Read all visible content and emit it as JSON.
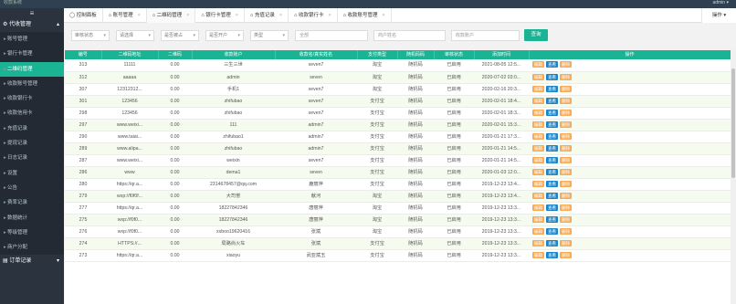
{
  "topbar": {
    "brand": "收款系统",
    "user": "admin ▾"
  },
  "sidebar": {
    "toggle": "≡",
    "group_top": "代收管理",
    "items": [
      {
        "label": "账号管理",
        "active": false
      },
      {
        "label": "银行卡管理",
        "active": false
      },
      {
        "label": "二维码管理",
        "active": true
      },
      {
        "label": "收款账号管理",
        "active": false
      },
      {
        "label": "收款银行卡",
        "active": false
      },
      {
        "label": "收款信用卡",
        "active": false
      },
      {
        "label": "充值记录",
        "active": false
      },
      {
        "label": "提现记录",
        "active": false
      },
      {
        "label": "日志记录",
        "active": false
      },
      {
        "label": "设置",
        "active": false
      },
      {
        "label": "公告",
        "active": false
      },
      {
        "label": "费率记录",
        "active": false
      },
      {
        "label": "数据统计",
        "active": false
      },
      {
        "label": "等级管理",
        "active": false
      },
      {
        "label": "商户分配",
        "active": false
      }
    ],
    "group_bottom": "订单记录"
  },
  "tabs": [
    {
      "label": "控制面板",
      "icon": "home-icon",
      "active": false
    },
    {
      "label": "账号管理",
      "active": false
    },
    {
      "label": "二维码管理",
      "active": true
    },
    {
      "label": "银行卡管理",
      "active": false
    },
    {
      "label": "充值记录",
      "active": false
    },
    {
      "label": "收款银行卡",
      "active": false
    },
    {
      "label": "收款账号管理",
      "active": false
    }
  ],
  "tab_ops": "操作 ▾",
  "filters": {
    "selects": [
      "审核状态",
      "请选择",
      "是否被占",
      "是否开户",
      "类型"
    ],
    "inputs": [
      "全部",
      "商户姓名",
      "收款账户"
    ],
    "search_button": "查询"
  },
  "table": {
    "headers": [
      "编号",
      "二维码地址",
      "二维码",
      "收款账户",
      "收款名/真实姓名",
      "支付类型",
      "随机码码",
      "审核状态",
      "添加时间",
      "操作"
    ],
    "rows": [
      [
        "313",
        "11111",
        "0.00",
        "三生三世",
        "seven7",
        "淘宝",
        "随机码",
        "已启用",
        "2021-08-05 12:5..."
      ],
      [
        "312",
        "aaaaa",
        "0.00",
        "admin",
        "seven",
        "淘宝",
        "随机码",
        "已启用",
        "2020-07-02 03:0..."
      ],
      [
        "307",
        "12312312...",
        "0.00",
        "手机1",
        "seven7",
        "淘宝",
        "随机码",
        "已启用",
        "2020-02-16 20:3..."
      ],
      [
        "301",
        "123456",
        "0.00",
        "zhifubao",
        "seven7",
        "支付宝",
        "随机码",
        "已启用",
        "2020-02-01 18:4..."
      ],
      [
        "298",
        "123456",
        "0.00",
        "zhifubao",
        "seven7",
        "支付宝",
        "随机码",
        "已启用",
        "2020-02-01 18:3..."
      ],
      [
        "297",
        "www.weixi...",
        "0.00",
        "111",
        "admin7",
        "支付宝",
        "随机码",
        "已启用",
        "2020-02-01 15:3..."
      ],
      [
        "290",
        "www.taiai...",
        "0.00",
        "zhifubao1",
        "admin7",
        "支付宝",
        "随机码",
        "已启用",
        "2020-01-21 17:3..."
      ],
      [
        "289",
        "www.alipa...",
        "0.00",
        "zhifubao",
        "admin7",
        "支付宝",
        "随机码",
        "已启用",
        "2020-01-21 14:5..."
      ],
      [
        "287",
        "www.weixi...",
        "0.00",
        "weixin",
        "seven7",
        "支付宝",
        "随机码",
        "已启用",
        "2020-01-21 14:5..."
      ],
      [
        "286",
        "www",
        "0.00",
        "dema1",
        "seven",
        "支付宝",
        "随机码",
        "已启用",
        "2020-01-03 12:0..."
      ],
      [
        "280",
        "https://qr.a...",
        "0.00",
        "2314678457@qq.com",
        "鹿丽萍",
        "支付宝",
        "随机码",
        "已启用",
        "2019-12-23 13:4..."
      ],
      [
        "279",
        "wxp://f0f0f...",
        "0.00",
        "大司誉",
        "献河",
        "淘宝",
        "随机码",
        "已启用",
        "2019-12-23 13:4..."
      ],
      [
        "277",
        "https://qr.a...",
        "0.00",
        "18227842346",
        "唐丽萍",
        "淘宝",
        "随机码",
        "已启用",
        "2019-12-23 13:3..."
      ],
      [
        "275",
        "wxp://f0f0...",
        "0.00",
        "18227842346",
        "唐丽萍",
        "淘宝",
        "随机码",
        "已启用",
        "2019-12-23 13:3..."
      ],
      [
        "276",
        "wxp://f0f0...",
        "0.00",
        "xxboo19620416",
        "张斌",
        "淘宝",
        "随机码",
        "已启用",
        "2019-12-23 13:3..."
      ],
      [
        "274",
        "HTTPS://...",
        "0.00",
        "局路尚火车",
        "张斌",
        "支付宝",
        "随机码",
        "已启用",
        "2019-12-23 13:3..."
      ],
      [
        "273",
        "https://qr.a...",
        "0.00",
        "xiaoyu",
        "武亚斌玉",
        "支付宝",
        "随机码",
        "已启用",
        "2019-12-23 13:3..."
      ]
    ],
    "actions": {
      "edit": "编辑",
      "view": "查看",
      "delete": "删除"
    }
  },
  "colors": {
    "accent": "#1ab394",
    "sidebar": "#2b333e",
    "edit": "#f8ac59",
    "view": "#1c84c6"
  }
}
